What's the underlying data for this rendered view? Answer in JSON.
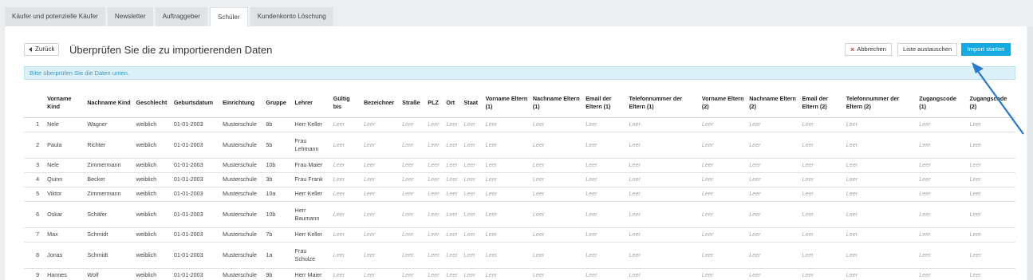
{
  "tabs": [
    {
      "label": "Käufer und potenzielle Käufer"
    },
    {
      "label": "Newsletter"
    },
    {
      "label": "Auftraggeber"
    },
    {
      "label": "Schüler"
    },
    {
      "label": "Kundenkonto Löschung"
    }
  ],
  "header": {
    "back_label": "Zurück",
    "title": "Überprüfen Sie die zu importierenden Daten",
    "cancel_label": "Abbrechen",
    "replace_label": "Liste austauschen",
    "import_label": "Import starten"
  },
  "info_text": "Bitte überprüfen Sie die Daten unten.",
  "empty_value": "Leer",
  "columns": [
    "",
    "Vorname Kind",
    "Nachname Kind",
    "Geschlecht",
    "Geburtsdatum",
    "Einrichtung",
    "Gruppe",
    "Lehrer",
    "Gültig bis",
    "Bezeichner",
    "Straße",
    "PLZ",
    "Ort",
    "Staat",
    "Vorname Eltern (1)",
    "Nachname Eltern (1)",
    "Email der Eltern (1)",
    "Telefonnummer der Eltern (1)",
    "Vorname Eltern (2)",
    "Nachname Eltern (2)",
    "Email der Eltern (2)",
    "Telefonnummer der Eltern (2)",
    "Zugangscode (1)",
    "Zugangscode (2)"
  ],
  "rows": [
    {
      "num": "1",
      "vorname": "Nele",
      "nachname": "Wagner",
      "geschlecht": "weiblich",
      "geburtsdatum": "01-01-2003",
      "einrichtung": "Musterschule",
      "gruppe": "8b",
      "lehrer": "Herr Keller"
    },
    {
      "num": "2",
      "vorname": "Paula",
      "nachname": "Richter",
      "geschlecht": "weiblich",
      "geburtsdatum": "01-01-2003",
      "einrichtung": "Musterschule",
      "gruppe": "5b",
      "lehrer": "Frau Lehmann"
    },
    {
      "num": "3",
      "vorname": "Nele",
      "nachname": "Zimmermann",
      "geschlecht": "weiblich",
      "geburtsdatum": "01-01-2003",
      "einrichtung": "Musterschule",
      "gruppe": "10b",
      "lehrer": "Frau Maier"
    },
    {
      "num": "4",
      "vorname": "Quinn",
      "nachname": "Becker",
      "geschlecht": "weiblich",
      "geburtsdatum": "01-01-2003",
      "einrichtung": "Musterschule",
      "gruppe": "3b",
      "lehrer": "Frau Frank"
    },
    {
      "num": "5",
      "vorname": "Viktor",
      "nachname": "Zimmermann",
      "geschlecht": "weiblich",
      "geburtsdatum": "01-01-2003",
      "einrichtung": "Musterschule",
      "gruppe": "10a",
      "lehrer": "Herr Keller"
    },
    {
      "num": "6",
      "vorname": "Oskar",
      "nachname": "Schäfer",
      "geschlecht": "weiblich",
      "geburtsdatum": "01-01-2003",
      "einrichtung": "Musterschule",
      "gruppe": "10b",
      "lehrer": "Herr Baumann"
    },
    {
      "num": "7",
      "vorname": "Max",
      "nachname": "Schmidt",
      "geschlecht": "weiblich",
      "geburtsdatum": "01-01-2003",
      "einrichtung": "Musterschule",
      "gruppe": "7b",
      "lehrer": "Herr Keller"
    },
    {
      "num": "8",
      "vorname": "Jonas",
      "nachname": "Schmidt",
      "geschlecht": "weiblich",
      "geburtsdatum": "01-01-2003",
      "einrichtung": "Musterschule",
      "gruppe": "1a",
      "lehrer": "Frau Schulze"
    },
    {
      "num": "9",
      "vorname": "Hannes",
      "nachname": "Wolf",
      "geschlecht": "weiblich",
      "geburtsdatum": "01-01-2003",
      "einrichtung": "Musterschule",
      "gruppe": "9b",
      "lehrer": "Herr Maier"
    }
  ],
  "colors": {
    "accent": "#18a9e0",
    "annotation_arrow": "#2b78c6",
    "info_bg": "#dbf0f7"
  },
  "icons": {
    "back": "caret-left-icon",
    "cancel": "close-icon"
  }
}
